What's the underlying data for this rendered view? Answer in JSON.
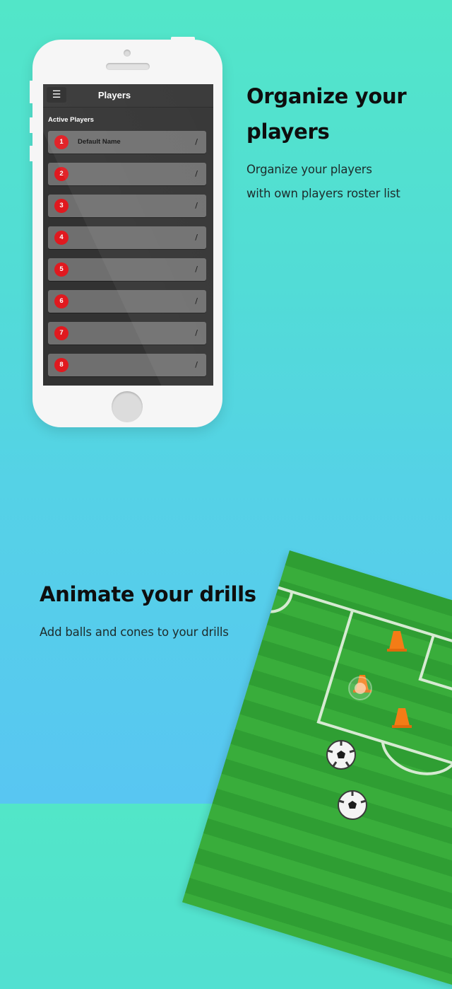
{
  "phone": {
    "screen": {
      "nav_title": "Players",
      "menu_icon": "hamburger-menu-icon",
      "section_label": "Active Players",
      "players": [
        {
          "number": "1",
          "name": "Default Name"
        },
        {
          "number": "2",
          "name": ""
        },
        {
          "number": "3",
          "name": ""
        },
        {
          "number": "4",
          "name": ""
        },
        {
          "number": "5",
          "name": ""
        },
        {
          "number": "6",
          "name": ""
        },
        {
          "number": "7",
          "name": ""
        },
        {
          "number": "8",
          "name": ""
        }
      ],
      "edit_icon": "pencil-icon",
      "badge_color": "#e0191f"
    }
  },
  "feature1": {
    "title_line1": "Organize your",
    "title_line2": "players",
    "desc_line1": "Organize your players",
    "desc_line2": "with own players roster list"
  },
  "feature2": {
    "title": "Animate your drills",
    "desc": "Add balls and cones to your drills"
  },
  "field": {
    "cones": 3,
    "balls": 2,
    "cone_color": "#f47c16",
    "grass_color": "#34a537"
  },
  "colors": {
    "bg_top": "#52e6c8",
    "bg_bottom": "#58c6f2"
  }
}
